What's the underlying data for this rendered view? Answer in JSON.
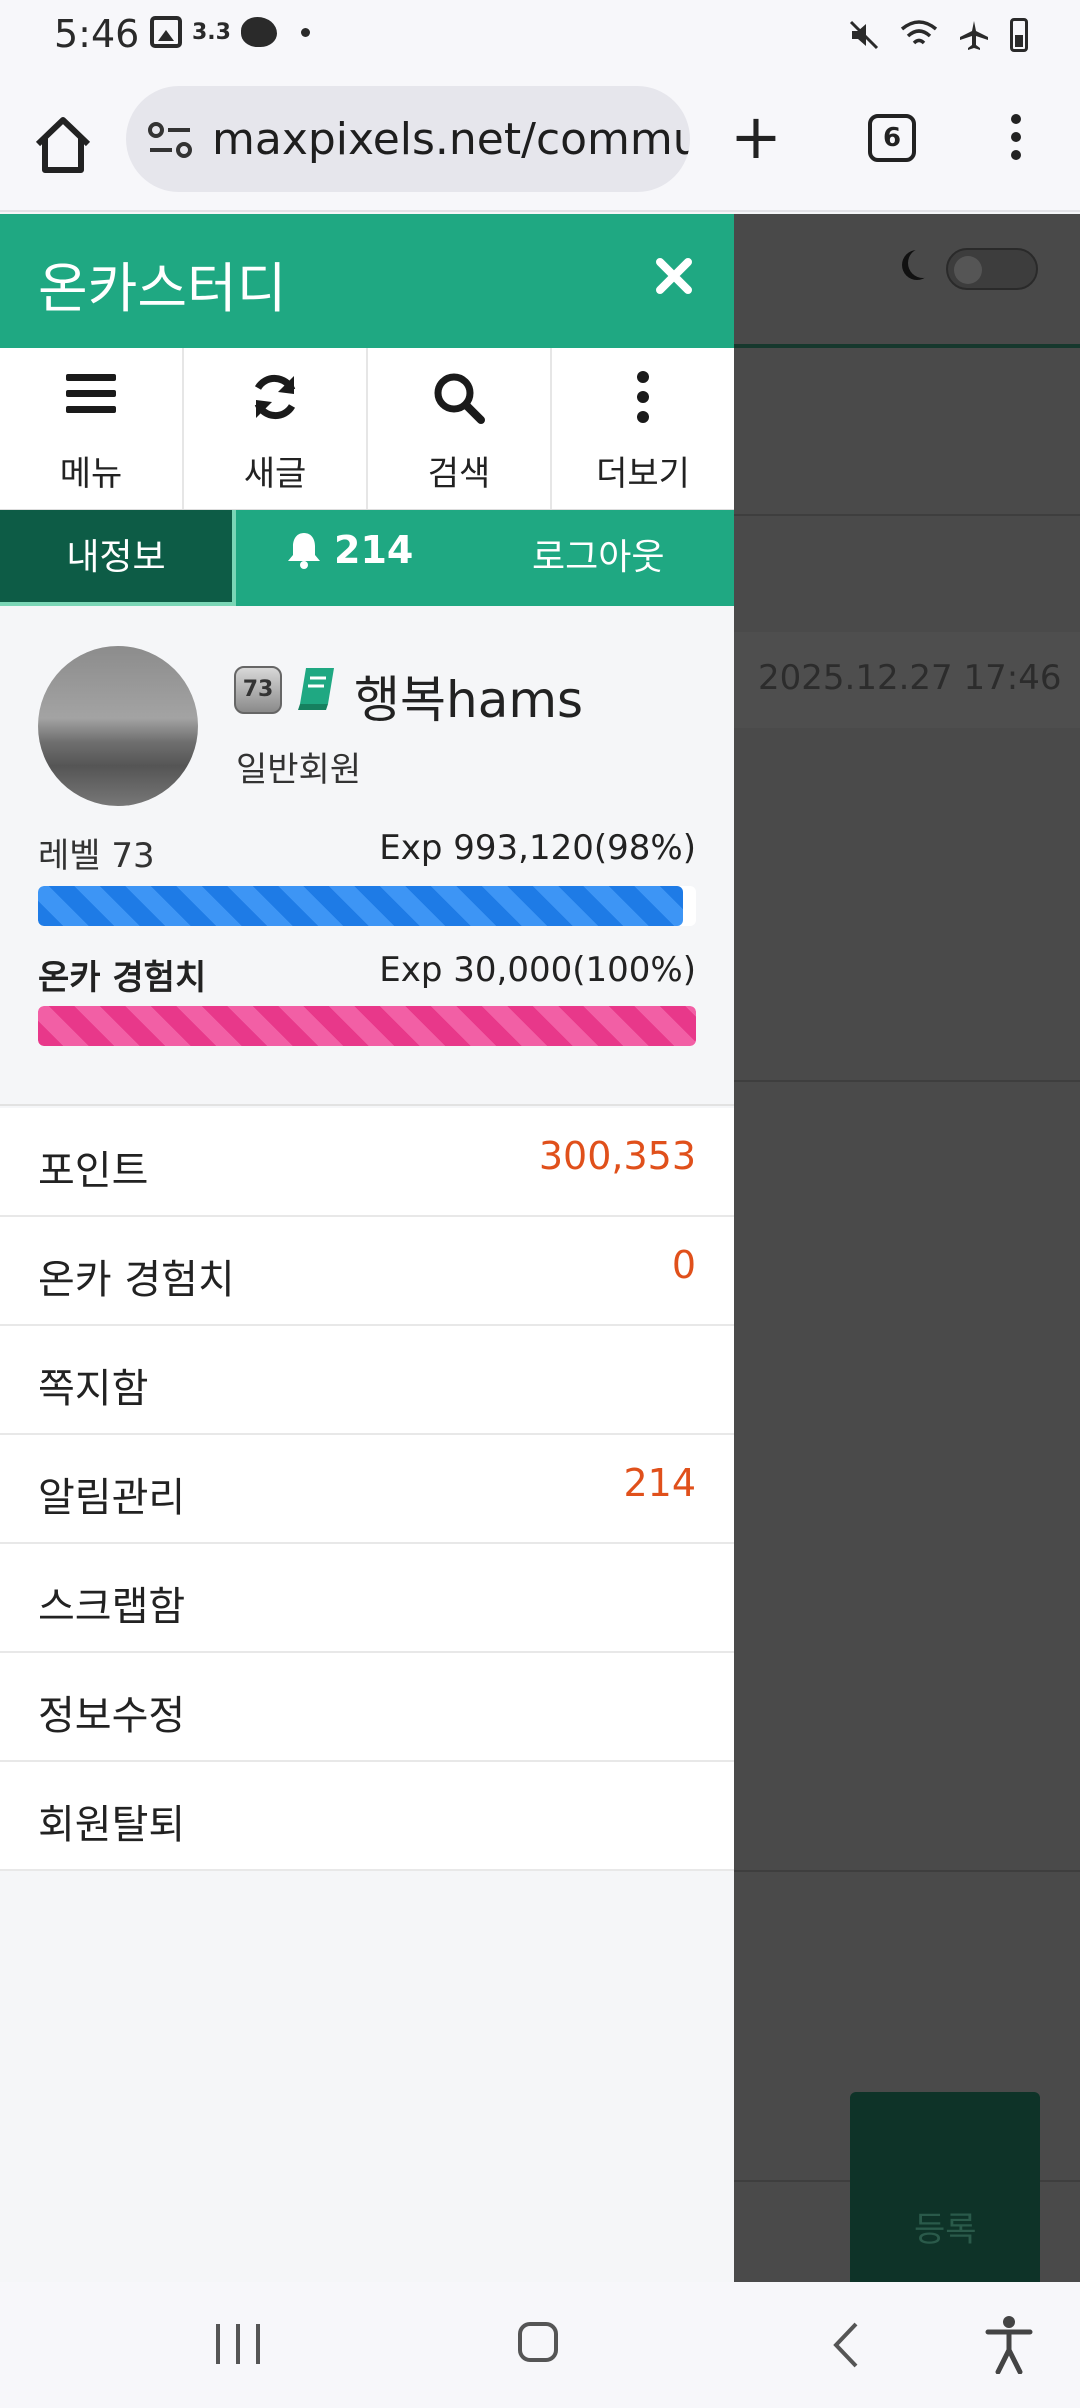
{
  "status_bar": {
    "time": "5:46",
    "speed": "3.3"
  },
  "browser": {
    "url": "maxpixels.net/commu",
    "tab_count": "6"
  },
  "background_page": {
    "date": "2025.12.27 17:46",
    "register_label": "등록"
  },
  "drawer": {
    "title": "온카스터디",
    "toolbar": [
      {
        "label": "메뉴",
        "icon": "hamburger-icon"
      },
      {
        "label": "새글",
        "icon": "refresh-icon"
      },
      {
        "label": "검색",
        "icon": "search-icon"
      },
      {
        "label": "더보기",
        "icon": "more-vertical-icon"
      }
    ],
    "tabs": {
      "my_info": "내정보",
      "notifications": "214",
      "logout": "로그아웃"
    },
    "profile": {
      "level_badge": "73",
      "username": "행복hams",
      "member_type": "일반회원",
      "level_label": "레벨 73",
      "exp": "Exp 993,120(98%)",
      "exp_percent": 98,
      "onka_label": "온카 경험치",
      "onka_exp": "Exp 30,000(100%)",
      "onka_percent": 100
    },
    "menu": [
      {
        "label": "포인트",
        "value": "300,353"
      },
      {
        "label": "온카 경험치",
        "value": "0"
      },
      {
        "label": "쪽지함",
        "value": ""
      },
      {
        "label": "알림관리",
        "value": "214"
      },
      {
        "label": "스크랩함",
        "value": ""
      },
      {
        "label": "정보수정",
        "value": ""
      },
      {
        "label": "회원탈퇴",
        "value": ""
      }
    ]
  },
  "colors": {
    "brand": "#1fa882",
    "brand_dark": "#0d5c46",
    "accent_value": "#e0501b",
    "exp_bar": "#1e7be6",
    "onka_bar": "#e8388a"
  }
}
